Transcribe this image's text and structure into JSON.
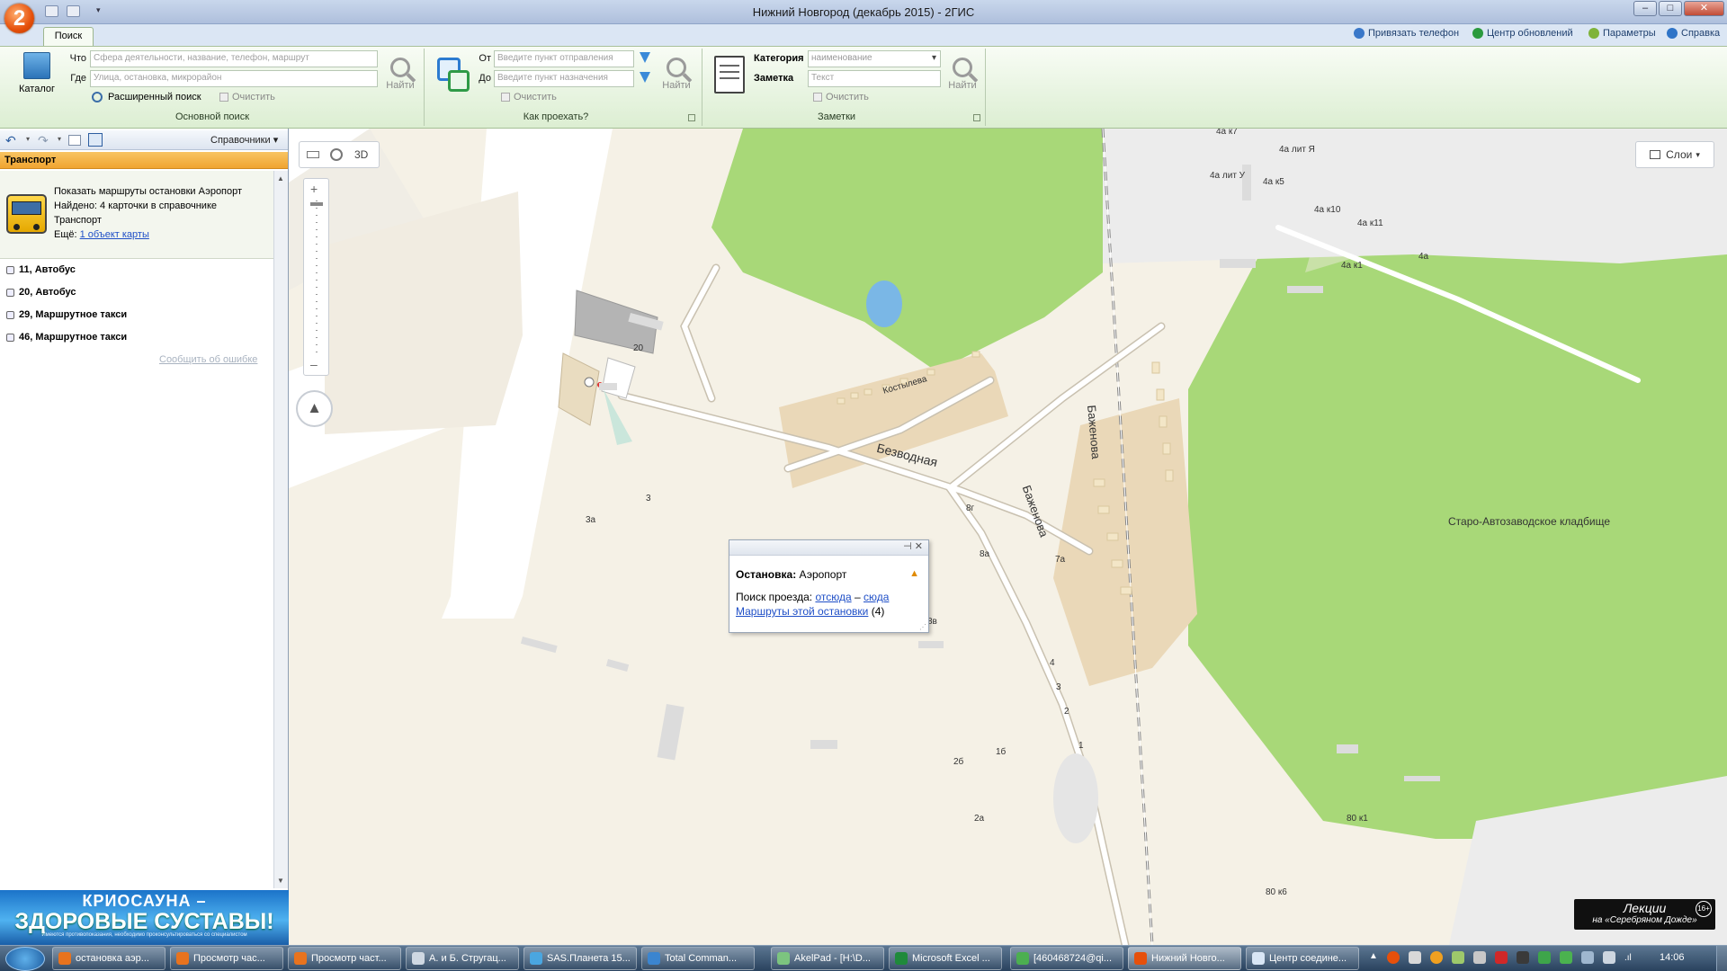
{
  "window": {
    "title": "Нижний Новгород (декабрь 2015) - 2ГИС",
    "logo": "2"
  },
  "ribbon": {
    "tab": "Поиск",
    "top_links": [
      "Привязать телефон",
      "Центр обновлений",
      "Параметры",
      "Справка"
    ],
    "main_search": {
      "catalog_label": "Каталог",
      "what_label": "Что",
      "what_placeholder": "Сфера деятельности, название, телефон, маршрут",
      "where_label": "Где",
      "where_placeholder": "Улица, остановка, микрорайон",
      "advanced_label": "Расширенный поиск",
      "clear_label": "Очистить",
      "find_label": "Найти",
      "group_label": "Основной поиск"
    },
    "route_search": {
      "from_label": "От",
      "from_placeholder": "Введите пункт отправления",
      "to_label": "До",
      "to_placeholder": "Введите пункт назначения",
      "clear_label": "Очистить",
      "find_label": "Найти",
      "group_label": "Как проехать?"
    },
    "notes": {
      "category_label": "Категория",
      "category_value": "наименование",
      "note_label": "Заметка",
      "note_placeholder": "Текст",
      "clear_label": "Очистить",
      "find_label": "Найти",
      "group_label": "Заметки"
    }
  },
  "sidebar": {
    "directories_label": "Справочники",
    "section_title": "Транспорт",
    "result": {
      "title": "Показать маршруты остановки Аэропорт",
      "found": "Найдено: 4 карточки в справочнике",
      "category": "Транспорт",
      "more_prefix": "Ещё:",
      "more_link": "1 объект карты"
    },
    "routes": [
      "11, Автобус",
      "20, Автобус",
      "29, Маршрутное такси",
      "46, Маршрутное такси"
    ],
    "report_error": "Сообщить об ошибке",
    "ad": {
      "line1": "КРИОСАУНА –",
      "line2": "ЗДОРОВЫЕ СУСТАВЫ!",
      "line3": "Имеются противопоказания, необходимо проконсультироваться со специалистом"
    }
  },
  "map": {
    "mode_3d": "3D",
    "layers_label": "Слои",
    "popup": {
      "title_bold": "Остановка:",
      "title_value": "Аэропорт",
      "route_label": "Поиск проезда:",
      "from_here": "отсюда",
      "dash": "–",
      "to_here": "сюда",
      "routes_link": "Маршруты этой остановки",
      "routes_count": "(4)"
    },
    "labels": {
      "bezvodnaya": "Безводная",
      "kostyleva": "Костылева",
      "bazhenova1": "Баженова",
      "bazhenova2": "Баженова",
      "cemetery": "Старо-Автозаводское кладбище",
      "h20": "20",
      "h3": "3",
      "h3a": "3а",
      "h8g": "8г",
      "h8a": "8а",
      "h8v": "8в",
      "h7a": "7а",
      "h4": "4",
      "h3b": "3",
      "h2": "2",
      "h1": "1",
      "h1b": "1б",
      "h2b": "2б",
      "h2a": "2а",
      "h4ak7": "4а к7",
      "h4alitYa": "4а лит Я",
      "h4alitU": "4а лит У",
      "h4ak5": "4а к5",
      "h4ak10": "4а к10",
      "h4ak11": "4а к11",
      "h4ak1": "4а к1",
      "h4a": "4а",
      "h80k1": "80 к1",
      "h80k6": "80 к6"
    },
    "ad_badge": {
      "line1": "Лекции",
      "line2": "на «Серебряном Дожде»",
      "age": "16+"
    }
  },
  "taskbar": {
    "items": [
      "остановка аэр...",
      "Просмотр час...",
      "Просмотр част...",
      "А. и Б. Стругац...",
      "SAS.Планета 15...",
      "Total Comman...",
      "AkelPad - [H:\\D...",
      "Microsoft Excel ...",
      "[460468724@qi...",
      "Нижний Новго...",
      "Центр соедине..."
    ],
    "clock": "14:06"
  },
  "colors": {
    "park": "#a8d878",
    "water": "#7ab7e6",
    "residential": "#ead8b8",
    "road": "#ffffff",
    "background": "#f5f1e6"
  }
}
